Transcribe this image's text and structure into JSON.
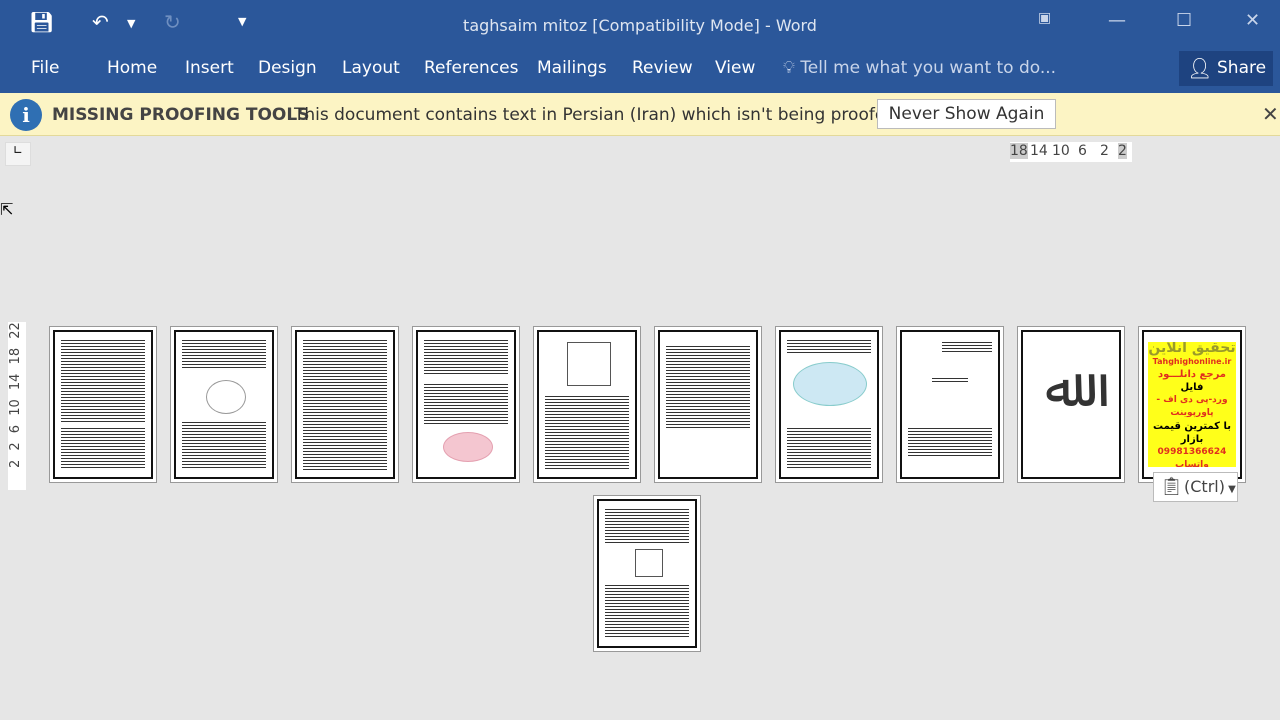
{
  "titlebar": {
    "title": "taghsaim mitoz [Compatibility Mode] - Word"
  },
  "ribbon": {
    "tabs": [
      "File",
      "Home",
      "Insert",
      "Design",
      "Layout",
      "References",
      "Mailings",
      "Review",
      "View"
    ],
    "tell_me": "Tell me what you want to do...",
    "share": "Share"
  },
  "message_bar": {
    "title": "MISSING PROOFING TOOLS",
    "text": "This document contains text in Persian (Iran) which isn't being proofed.",
    "button": "Never Show Again"
  },
  "hruler": [
    "18",
    "14",
    "10",
    "6",
    "2",
    "2"
  ],
  "vruler": "2 2 6 10 14 18 22",
  "ad": {
    "title": "تحقیق آنلاین",
    "site": "Tahghighonline.ir",
    "line1": "مرجع دانلـــود",
    "line2": "فایل",
    "line3": "ورد-پی دی اف - پاورپوینت",
    "line4": "با کمترین قیمت بازار",
    "phone": "09981366624 واتساپ"
  },
  "paste_options": "(Ctrl)",
  "colors": {
    "brand": "#2b579a",
    "message_bar": "#fcf4c4",
    "ad_background": "#ffff1a"
  }
}
